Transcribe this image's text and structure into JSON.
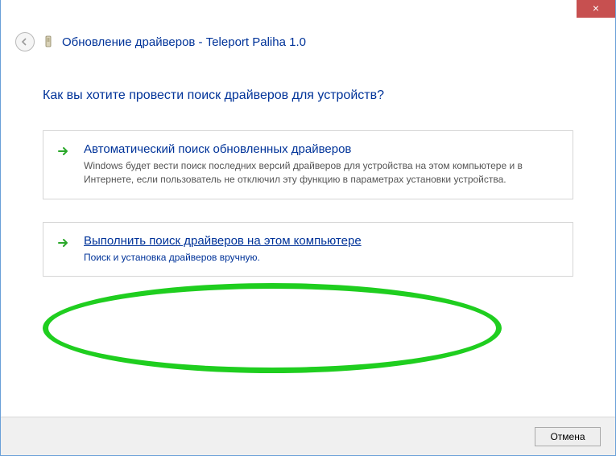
{
  "titlebar": {
    "close_glyph": "×"
  },
  "header": {
    "title": "Обновление драйверов - Teleport Paliha 1.0"
  },
  "heading": "Как вы хотите провести поиск драйверов для устройств?",
  "options": [
    {
      "title": "Автоматический поиск обновленных драйверов",
      "desc": "Windows будет вести поиск последних версий драйверов для устройства на этом компьютере и в Интернете, если пользователь не отключил эту функцию в параметрах установки устройства."
    },
    {
      "title": "Выполнить поиск драйверов на этом компьютере",
      "desc": "Поиск и установка драйверов вручную."
    }
  ],
  "footer": {
    "cancel_label": "Отмена"
  }
}
